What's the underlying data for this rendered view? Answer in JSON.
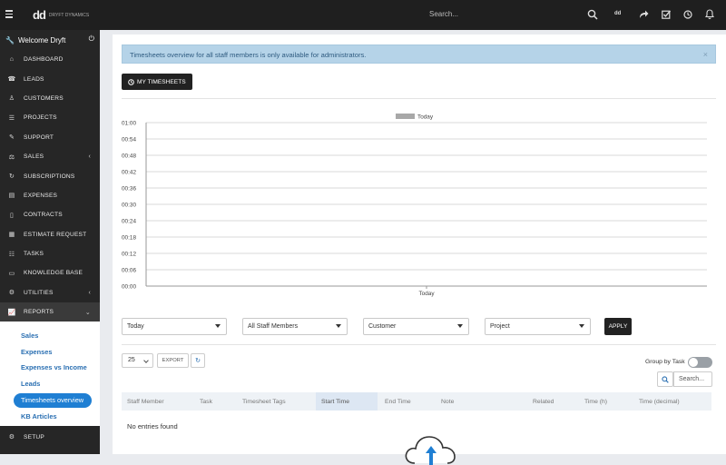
{
  "topbar": {
    "logo_mark": "dd",
    "logo_line1": "DRYFT DYNAMICS",
    "logo_line2": "",
    "search_placeholder": "Search...",
    "user_initials": "dd"
  },
  "sidebar": {
    "welcome": "Welcome Dryft",
    "items": [
      {
        "label": "DASHBOARD",
        "icon": "home-icon"
      },
      {
        "label": "LEADS",
        "icon": "tty-icon"
      },
      {
        "label": "CUSTOMERS",
        "icon": "user-icon"
      },
      {
        "label": "PROJECTS",
        "icon": "bars-icon"
      },
      {
        "label": "SUPPORT",
        "icon": "ticket-icon"
      },
      {
        "label": "SALES",
        "icon": "balance-scale-icon",
        "chevron": "‹"
      },
      {
        "label": "SUBSCRIPTIONS",
        "icon": "refresh-icon"
      },
      {
        "label": "EXPENSES",
        "icon": "file-icon"
      },
      {
        "label": "CONTRACTS",
        "icon": "contract-icon"
      },
      {
        "label": "ESTIMATE REQUEST",
        "icon": "list-icon"
      },
      {
        "label": "TASKS",
        "icon": "tasks-icon"
      },
      {
        "label": "KNOWLEDGE BASE",
        "icon": "folder-icon"
      },
      {
        "label": "UTILITIES",
        "icon": "cogs-icon",
        "chevron": "‹"
      },
      {
        "label": "REPORTS",
        "icon": "area-chart-icon",
        "chevron": "⌄"
      }
    ],
    "submenu": [
      "Sales",
      "Expenses",
      "Expenses vs Income",
      "Leads",
      "Timesheets overview",
      "KB Articles"
    ],
    "setup": "SETUP"
  },
  "main": {
    "alert": "Timesheets overview for all staff members is only available for administrators.",
    "my_timesheets": "MY TIMESHEETS",
    "filters": {
      "period": "Today",
      "staff": "All Staff Members",
      "customer": "Customer",
      "project": "Project",
      "apply": "APPLY"
    },
    "table": {
      "length": "25",
      "export": "EXPORT",
      "group_by_task": "Group by Task",
      "search_placeholder": "Search...",
      "columns": [
        "Staff Member",
        "Task",
        "Timesheet Tags",
        "Start Time",
        "End Time",
        "Note",
        "Related",
        "Time (h)",
        "Time (decimal)"
      ],
      "empty": "No entries found"
    }
  },
  "chart_data": {
    "type": "bar",
    "categories": [
      "Today"
    ],
    "series": [
      {
        "name": "Today",
        "values": [
          0
        ]
      }
    ],
    "title": "",
    "xlabel": "",
    "ylabel": "",
    "yticks": [
      "01:00",
      "00:54",
      "00:48",
      "00:42",
      "00:36",
      "00:30",
      "00:24",
      "00:18",
      "00:12",
      "00:06",
      "00:00"
    ],
    "ylim": [
      0,
      60
    ],
    "legend": "top-center",
    "grid": true,
    "legend_color": "#a8a8a8"
  }
}
